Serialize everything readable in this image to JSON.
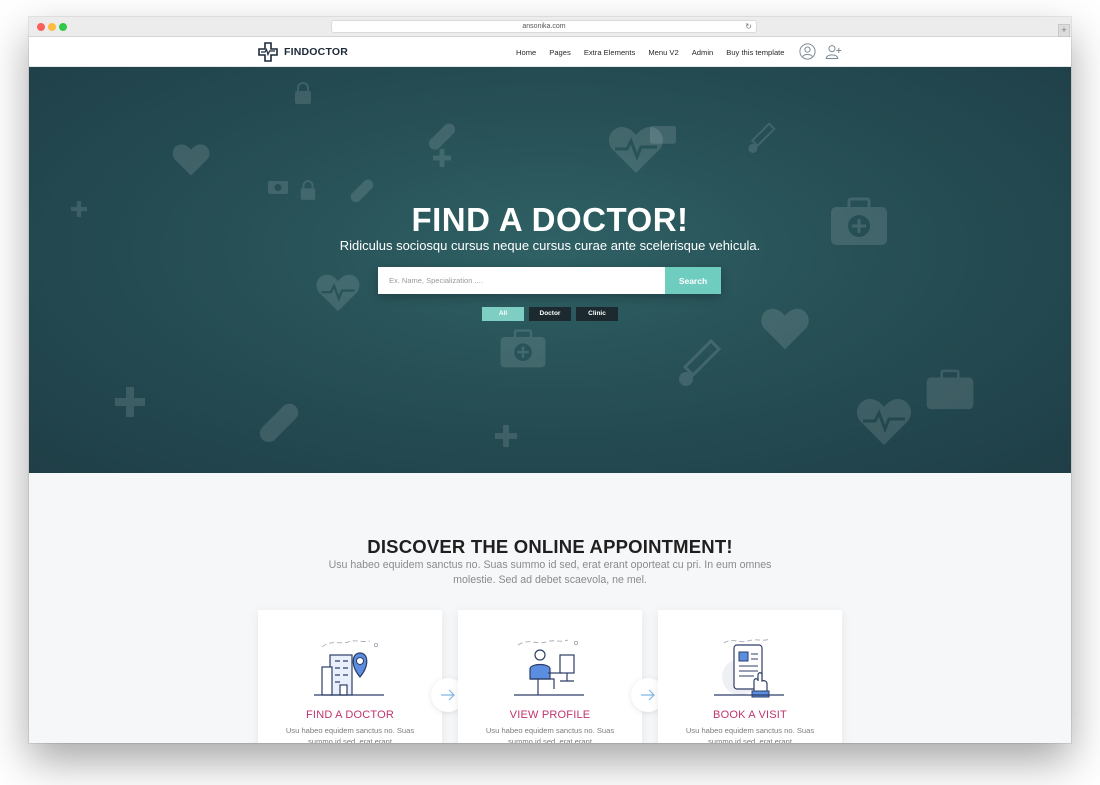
{
  "browser": {
    "url": "ansonika.com"
  },
  "header": {
    "logo_text": "FINDOCTOR",
    "nav": [
      "Home",
      "Pages",
      "Extra Elements",
      "Menu V2",
      "Admin",
      "Buy this template"
    ]
  },
  "hero": {
    "title": "FIND A DOCTOR!",
    "subtitle": "Ridiculus sociosqu cursus neque cursus curae ante scelerisque vehicula.",
    "search_placeholder": "Ex. Name, Specialization ....",
    "search_button": "Search",
    "filters": [
      "All",
      "Doctor",
      "Clinic"
    ],
    "active_filter": "All"
  },
  "section": {
    "title_prefix": "DISCOVER THE ",
    "title_bold": "ONLINE",
    "title_suffix": " APPOINTMENT!",
    "text": "Usu habeo equidem sanctus no. Suas summo id sed, erat erant oporteat cu pri. In eum omnes molestie. Sed ad debet scaevola, ne mel."
  },
  "cards": [
    {
      "title": "FIND A DOCTOR",
      "text": "Usu habeo equidem sanctus no. Suas summo id sed, erat erant"
    },
    {
      "title": "VIEW PROFILE",
      "text": "Usu habeo equidem sanctus no. Suas summo id sed, erat erant"
    },
    {
      "title": "BOOK A VISIT",
      "text": "Usu habeo equidem sanctus no. Suas summo id sed, erat erant"
    }
  ],
  "icons": {
    "logo": "medical-cross-logo-icon",
    "user": "user-icon",
    "add_user": "add-user-icon",
    "arrow": "arrow-right-icon",
    "card_1": "map-pin-building-icon",
    "card_2": "person-at-desk-icon",
    "card_3": "tablet-tap-icon"
  },
  "colors": {
    "accent": "#6fcdc0",
    "hero_bg": "#264f55",
    "card_title": "#c0336f",
    "dark_button": "#1c2a30"
  }
}
